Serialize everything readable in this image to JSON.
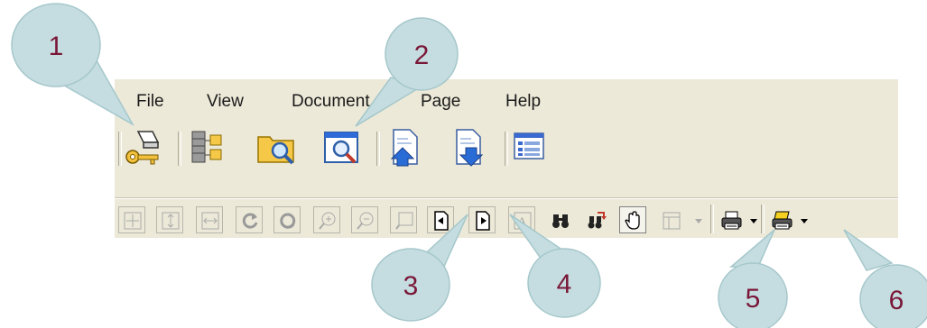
{
  "menu": {
    "items": [
      {
        "label": "File"
      },
      {
        "label": "View"
      },
      {
        "label": "Document"
      },
      {
        "label": "Page"
      },
      {
        "label": "Help"
      }
    ]
  },
  "callouts": [
    {
      "label": "1"
    },
    {
      "label": "2"
    },
    {
      "label": "3"
    },
    {
      "label": "4"
    },
    {
      "label": "5"
    },
    {
      "label": "6"
    }
  ],
  "icons": {
    "toolbar1": [
      "eraser-key-icon",
      "database-tree-icon",
      "folder-search-icon",
      "window-zoom-icon",
      "page-up-icon",
      "page-down-icon",
      "list-view-icon"
    ],
    "toolbar2": [
      "fit-page-icon",
      "fit-height-icon",
      "fit-width-icon",
      "rotate-left-icon",
      "rotate-right-icon",
      "zoom-in-icon",
      "zoom-out-icon",
      "zoom-box-icon",
      "previous-page-icon",
      "next-page-icon",
      "text-select-icon",
      "find-icon",
      "find-next-icon",
      "hand-tool-icon",
      "layout-icon",
      "print-icon",
      "print-setup-icon"
    ]
  },
  "colors": {
    "callout_fill": "#c5dde0",
    "callout_text": "#7a1738",
    "toolbar_bg": "#ece9d8"
  }
}
